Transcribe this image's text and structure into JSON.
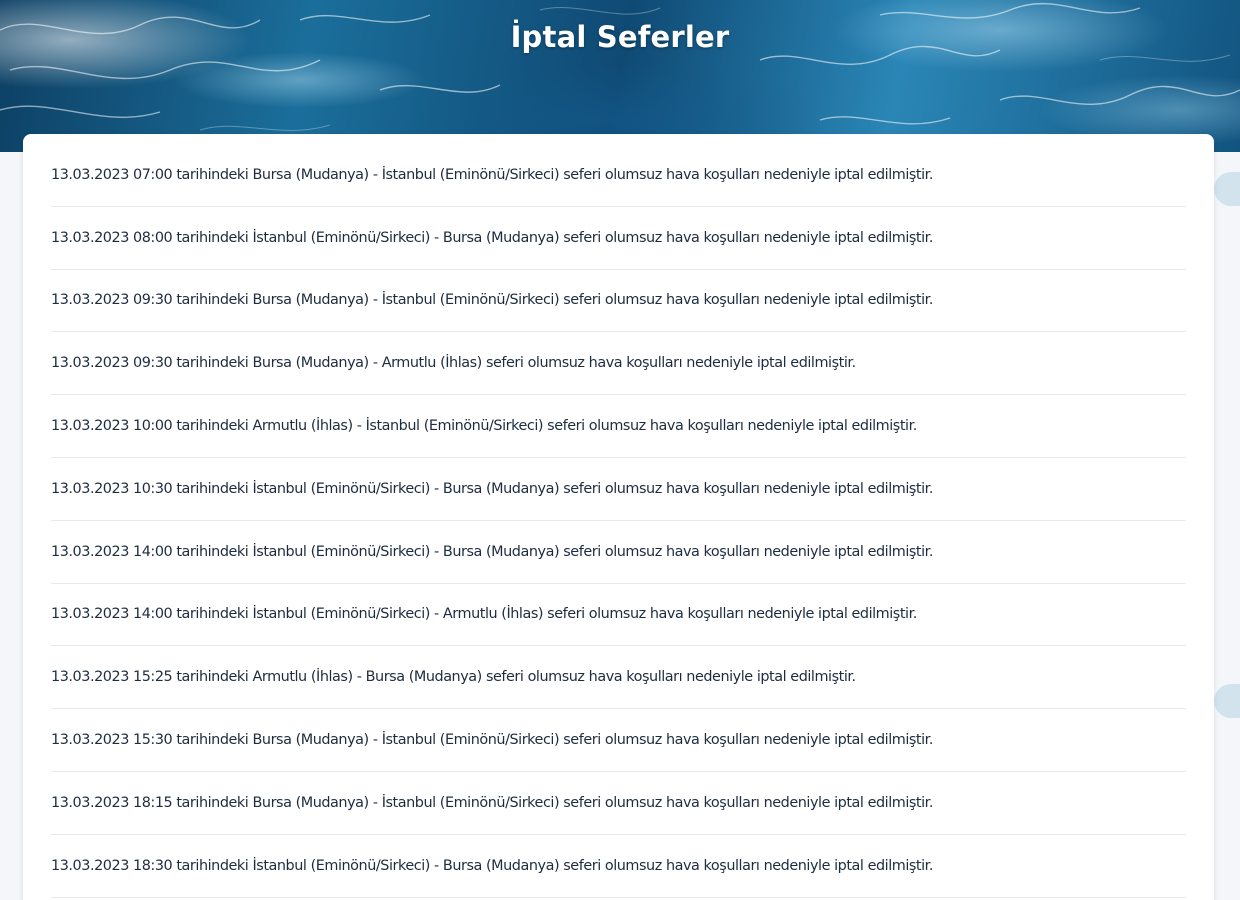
{
  "header": {
    "title": "İptal Seferler"
  },
  "notices": [
    "13.03.2023 07:00 tarihindeki Bursa (Mudanya) - İstanbul (Eminönü/Sirkeci) seferi olumsuz hava koşulları nedeniyle iptal edilmiştir.",
    "13.03.2023 08:00 tarihindeki İstanbul (Eminönü/Sirkeci) - Bursa (Mudanya) seferi olumsuz hava koşulları nedeniyle iptal edilmiştir.",
    "13.03.2023 09:30 tarihindeki Bursa (Mudanya) - İstanbul (Eminönü/Sirkeci) seferi olumsuz hava koşulları nedeniyle iptal edilmiştir.",
    "13.03.2023 09:30 tarihindeki Bursa (Mudanya) - Armutlu (İhlas) seferi olumsuz hava koşulları nedeniyle iptal edilmiştir.",
    "13.03.2023 10:00 tarihindeki Armutlu (İhlas) - İstanbul (Eminönü/Sirkeci) seferi olumsuz hava koşulları nedeniyle iptal edilmiştir.",
    "13.03.2023 10:30 tarihindeki İstanbul (Eminönü/Sirkeci) - Bursa (Mudanya) seferi olumsuz hava koşulları nedeniyle iptal edilmiştir.",
    "13.03.2023 14:00 tarihindeki İstanbul (Eminönü/Sirkeci) - Bursa (Mudanya) seferi olumsuz hava koşulları nedeniyle iptal edilmiştir.",
    "13.03.2023 14:00 tarihindeki İstanbul (Eminönü/Sirkeci) - Armutlu (İhlas) seferi olumsuz hava koşulları nedeniyle iptal edilmiştir.",
    "13.03.2023 15:25 tarihindeki Armutlu (İhlas) - Bursa (Mudanya) seferi olumsuz hava koşulları nedeniyle iptal edilmiştir.",
    "13.03.2023 15:30 tarihindeki Bursa (Mudanya) - İstanbul (Eminönü/Sirkeci) seferi olumsuz hava koşulları nedeniyle iptal edilmiştir.",
    "13.03.2023 18:15 tarihindeki Bursa (Mudanya) - İstanbul (Eminönü/Sirkeci) seferi olumsuz hava koşulları nedeniyle iptal edilmiştir.",
    "13.03.2023 18:30 tarihindeki İstanbul (Eminönü/Sirkeci) - Bursa (Mudanya) seferi olumsuz hava koşulları nedeniyle iptal edilmiştir."
  ],
  "colors": {
    "text": "#1d2c3f",
    "header_text": "#ffffff",
    "divider": "#e7e9ec",
    "page_bg": "#f4f6f9"
  }
}
